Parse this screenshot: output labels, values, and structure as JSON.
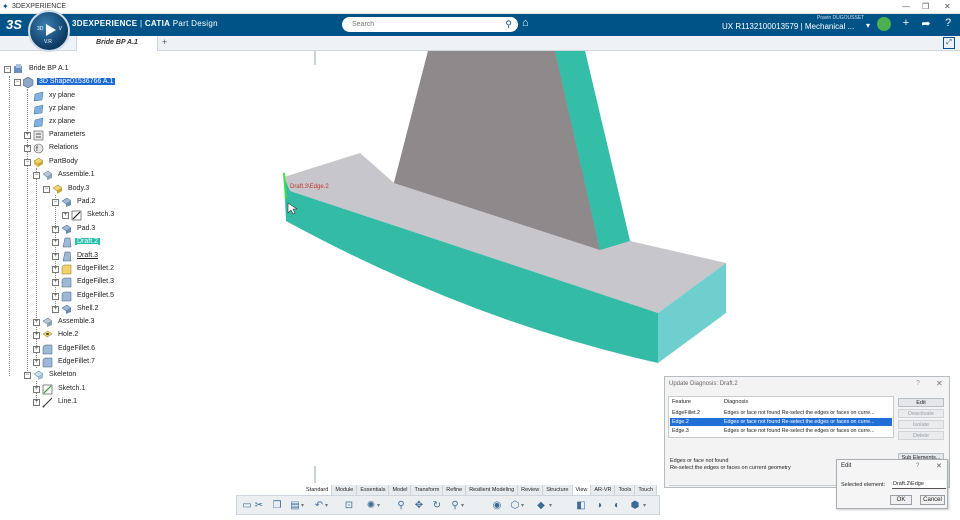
{
  "os_window": {
    "title": "3DEXPERIENCE"
  },
  "topbar": {
    "brand_main": "3DEXPERIENCE",
    "brand_sep": "|",
    "brand_product": "CATIA",
    "brand_app": "Part Design",
    "search_placeholder": "Search",
    "user_name": "Pravin DUGOUSSET",
    "context": "UX R1132100013579 | Mechanical ...",
    "compass": {
      "version": "V.R",
      "left": "3D",
      "right": "V"
    }
  },
  "tabs": [
    {
      "label": "Bride BP A.1"
    }
  ],
  "tree": {
    "items": [
      {
        "label": "Bride BP A.1"
      },
      {
        "label": "3D Shape01536766 A.1"
      },
      {
        "label": "xy plane"
      },
      {
        "label": "yz plane"
      },
      {
        "label": "zx plane"
      },
      {
        "label": "Parameters"
      },
      {
        "label": "Relations"
      },
      {
        "label": "PartBody"
      },
      {
        "label": "Assemble.1"
      },
      {
        "label": "Body.3"
      },
      {
        "label": "Pad.2"
      },
      {
        "label": "Sketch.3"
      },
      {
        "label": "Pad.3"
      },
      {
        "label": "Draft.2"
      },
      {
        "label": "Draft.3"
      },
      {
        "label": "EdgeFillet.2"
      },
      {
        "label": "EdgeFillet.3"
      },
      {
        "label": "EdgeFillet.5"
      },
      {
        "label": "Shell.2"
      },
      {
        "label": "Assemble.3"
      },
      {
        "label": "Hole.2"
      },
      {
        "label": "EdgeFillet.6"
      },
      {
        "label": "EdgeFillet.7"
      },
      {
        "label": "Skeleton"
      },
      {
        "label": "Sketch.1"
      },
      {
        "label": "Line.1"
      }
    ]
  },
  "viewport": {
    "selection_label": "Draft.3\\Edge.2",
    "colors": {
      "face_grey": "#c8c8cc",
      "face_teal": "#36bba6",
      "fin_dark": "#8e8a8b"
    }
  },
  "section_tabs": [
    "Standard",
    "Module",
    "Essentials",
    "Model",
    "Transform",
    "Refine",
    "Resilient Modeling",
    "Review",
    "Structure",
    "View",
    "AR-VR",
    "Tools",
    "Touch"
  ],
  "update_diagnosis": {
    "title": "Update Diagnosis: Draft.2",
    "columns": {
      "feature": "Feature",
      "diagnosis": "Diagnosis"
    },
    "rows": [
      {
        "feature": "EdgeFillet.2",
        "diagnosis": "Edges or face not found Re-select the edges or faces on curre..."
      },
      {
        "feature": "Edge.2",
        "diagnosis": "Edges or face not found Re-select the edges or faces on curre..."
      },
      {
        "feature": "Edge.3",
        "diagnosis": "Edges or face not found Re-select the edges or faces on curre..."
      }
    ],
    "buttons": {
      "edit": "Edit",
      "deactivate": "Deactivate",
      "isolate": "Isolate",
      "delete": "Delete",
      "sub_elements": "Sub Elements..."
    },
    "message_line1": "Edges or face not found",
    "message_line2": "Re-select the edges or faces on current geometry"
  },
  "edit_dialog": {
    "title": "Edit",
    "help": "?",
    "selected_label": "Selected element:",
    "selected_value": "Draft.2\\Edge",
    "ok": "OK",
    "cancel": "Cancel"
  }
}
